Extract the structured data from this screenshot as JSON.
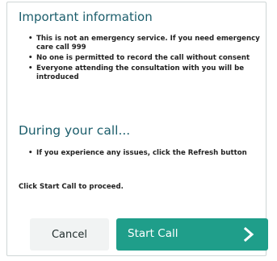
{
  "section1": {
    "title": "Important information",
    "bullets": [
      "This is not an emergency service. If you need emergency care call 999",
      "No one is permitted to record the call without consent",
      "Everyone attending the consultation with you will be introduced"
    ]
  },
  "section2": {
    "title": "During your call...",
    "bullets": [
      "If you experience any issues, click the Refresh button"
    ]
  },
  "proceed_text": "Click Start Call to proceed.",
  "buttons": {
    "cancel": "Cancel",
    "start": "Start Call"
  },
  "icons": {
    "start_chevron": "chevron-right-icon"
  },
  "colors": {
    "heading": "#1b5d6b",
    "primary": "#1f9e8a",
    "secondary_bg": "#f1f3f3"
  }
}
